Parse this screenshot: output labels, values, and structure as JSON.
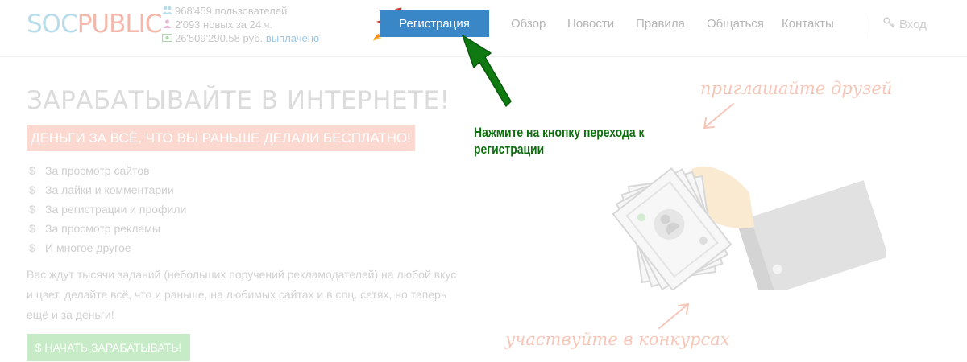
{
  "header": {
    "logo": {
      "part1": "SOC",
      "part2": "PUBLIC"
    },
    "stats": {
      "users": "968'459 пользователей",
      "new_users": "2'093 новых за 24 ч.",
      "payouts_amount": "26'509'290.58 руб.",
      "payouts_label": "выплачено"
    },
    "register_label": "Регистрация",
    "nav": [
      "Обзор",
      "Новости",
      "Правила",
      "Общаться",
      "Контакты"
    ],
    "login_label": "Вход"
  },
  "hero": {
    "title": "ЗАРАБАТЫВАЙТЕ В ИНТЕРНЕТЕ!",
    "tagline": "ДЕНЬГИ ЗА ВСЁ, ЧТО ВЫ РАНЬШЕ ДЕЛАЛИ БЕСПЛАТНО!",
    "features": [
      "За просмотр сайтов",
      "За лайки и комментарии",
      "За регистрации и профили",
      "За просмотр рекламы",
      "И многое другое"
    ],
    "description": "Вас ждут тысячи заданий (небольших поручений рекламодателей) на любой вкус и цвет, делайте всё, что и раньше, на любимых сайтах и в соц. сетях, но теперь ещё и за деньги!",
    "start_button": "$ НАЧАТЬ ЗАРАБАТЫВАТЬ!"
  },
  "annotation": {
    "hint": "Нажмите на кнопку перехода к регистрации"
  },
  "illustration": {
    "invite_text": "приглашайте друзей",
    "contest_text": "участвуйте в конкурсах"
  },
  "colors": {
    "accent_blue": "#3a87c8",
    "annotation_green": "#0c6e0c",
    "tagline_bg": "#fbd9d1",
    "start_button_bg": "#c6ebc6"
  },
  "icons": {
    "users": "users-icon",
    "new_users": "user-icon",
    "payouts": "money-icon",
    "register": "rocket-icon",
    "login": "key-icon",
    "feature": "dollar-icon"
  }
}
